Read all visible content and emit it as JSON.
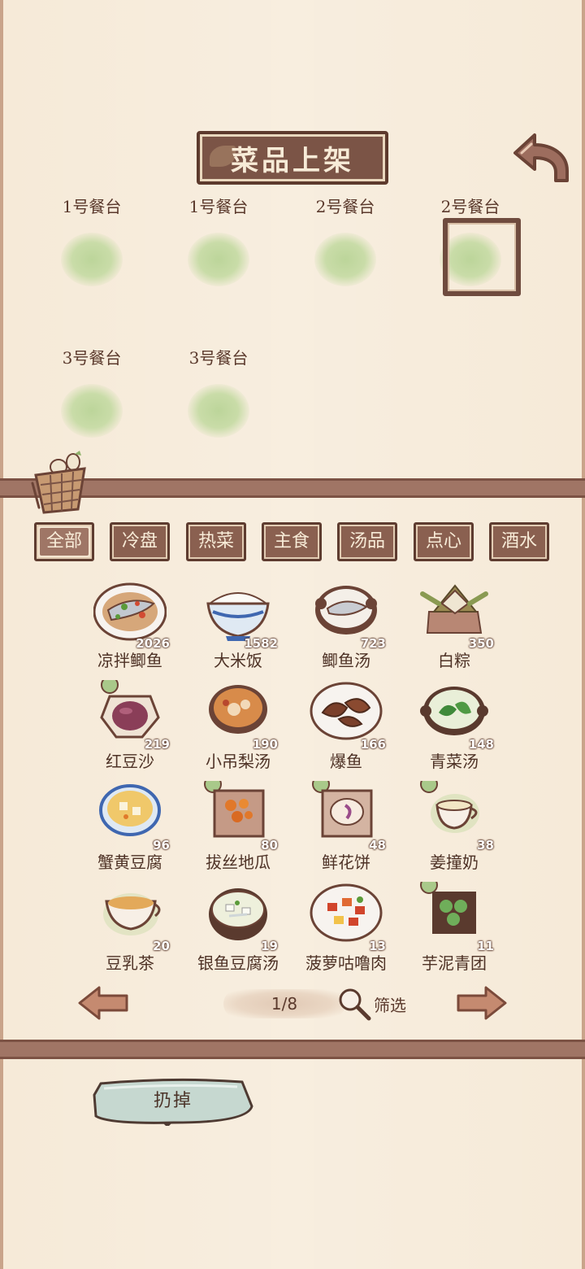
{
  "header": {
    "title": "菜品上架"
  },
  "tables": [
    {
      "label": "1号餐台",
      "selected": false
    },
    {
      "label": "1号餐台",
      "selected": false
    },
    {
      "label": "2号餐台",
      "selected": false
    },
    {
      "label": "2号餐台",
      "selected": true
    },
    {
      "label": "3号餐台",
      "selected": false
    },
    {
      "label": "3号餐台",
      "selected": false
    }
  ],
  "tabs": [
    {
      "label": "全部",
      "active": true
    },
    {
      "label": "冷盘",
      "active": false
    },
    {
      "label": "热菜",
      "active": false
    },
    {
      "label": "主食",
      "active": false
    },
    {
      "label": "汤品",
      "active": false
    },
    {
      "label": "点心",
      "active": false
    },
    {
      "label": "酒水",
      "active": false
    }
  ],
  "dishes": [
    {
      "name": "凉拌鲫鱼",
      "count": "2026",
      "icon": "cold-fish-plate-icon"
    },
    {
      "name": "大米饭",
      "count": "1582",
      "icon": "rice-bowl-icon"
    },
    {
      "name": "鲫鱼汤",
      "count": "723",
      "icon": "fish-soup-pot-icon"
    },
    {
      "name": "白粽",
      "count": "350",
      "icon": "zongzi-icon"
    },
    {
      "name": "红豆沙",
      "count": "219",
      "icon": "red-bean-paste-icon"
    },
    {
      "name": "小吊梨汤",
      "count": "190",
      "icon": "pear-soup-icon"
    },
    {
      "name": "爆鱼",
      "count": "166",
      "icon": "fried-fish-plate-icon"
    },
    {
      "name": "青菜汤",
      "count": "148",
      "icon": "greens-soup-pot-icon"
    },
    {
      "name": "蟹黄豆腐",
      "count": "96",
      "icon": "crab-tofu-bowl-icon"
    },
    {
      "name": "拔丝地瓜",
      "count": "80",
      "icon": "candied-sweet-potato-icon"
    },
    {
      "name": "鲜花饼",
      "count": "48",
      "icon": "flower-cake-icon"
    },
    {
      "name": "姜撞奶",
      "count": "38",
      "icon": "ginger-milk-cup-icon"
    },
    {
      "name": "豆乳茶",
      "count": "20",
      "icon": "soy-milk-tea-icon"
    },
    {
      "name": "银鱼豆腐汤",
      "count": "19",
      "icon": "whitebait-tofu-soup-icon"
    },
    {
      "name": "菠萝咕噜肉",
      "count": "13",
      "icon": "sweet-sour-pork-icon"
    },
    {
      "name": "芋泥青团",
      "count": "11",
      "icon": "taro-green-dumpling-icon"
    }
  ],
  "pagination": {
    "label": "1/8"
  },
  "filter": {
    "label": "筛选"
  },
  "discard": {
    "label": "扔掉"
  },
  "colors": {
    "background": "#f6ead8",
    "wood_dark": "#7b5446",
    "plate_green": "#c9dca8",
    "discard_teal": "#c5d6cf"
  }
}
